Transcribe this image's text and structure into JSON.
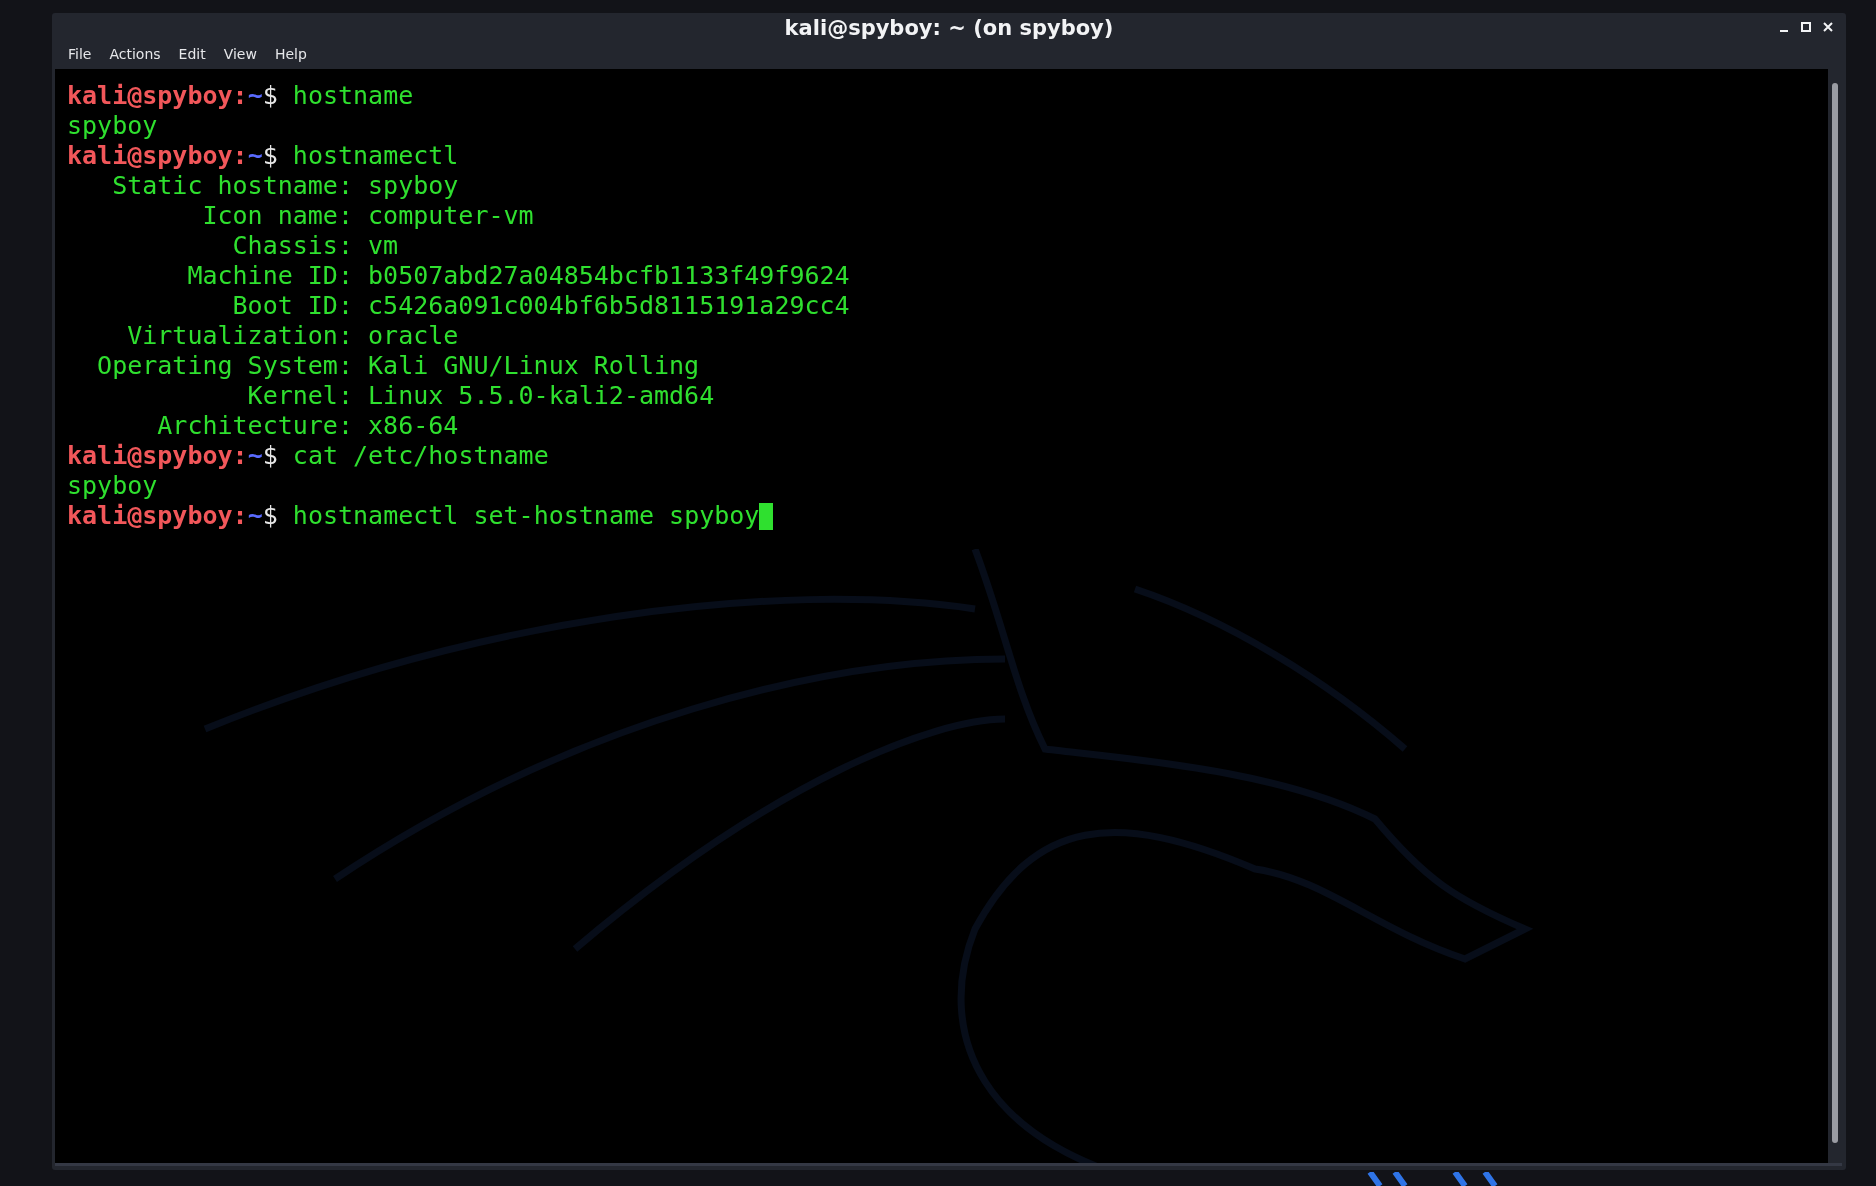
{
  "window": {
    "title": "kali@spyboy: ~ (on spyboy)"
  },
  "menu": [
    "File",
    "Actions",
    "Edit",
    "View",
    "Help"
  ],
  "terminal": {
    "lines": [
      {
        "kind": "prompt",
        "user_host": "kali@spyboy",
        "separator": ":",
        "path": "~",
        "symbol": "$",
        "command": "hostname",
        "cursor": false
      },
      {
        "kind": "output",
        "text": "spyboy"
      },
      {
        "kind": "prompt",
        "user_host": "kali@spyboy",
        "separator": ":",
        "path": "~",
        "symbol": "$",
        "command": "hostnamectl",
        "cursor": false
      },
      {
        "kind": "output",
        "text": "   Static hostname: spyboy"
      },
      {
        "kind": "output",
        "text": "         Icon name: computer-vm"
      },
      {
        "kind": "output",
        "text": "           Chassis: vm"
      },
      {
        "kind": "output",
        "text": "        Machine ID: b0507abd27a04854bcfb1133f49f9624"
      },
      {
        "kind": "output",
        "text": "           Boot ID: c5426a091c004bf6b5d8115191a29cc4"
      },
      {
        "kind": "output",
        "text": "    Virtualization: oracle"
      },
      {
        "kind": "output",
        "text": "  Operating System: Kali GNU/Linux Rolling"
      },
      {
        "kind": "output",
        "text": "            Kernel: Linux 5.5.0-kali2-amd64"
      },
      {
        "kind": "output",
        "text": "      Architecture: x86-64"
      },
      {
        "kind": "prompt",
        "user_host": "kali@spyboy",
        "separator": ":",
        "path": "~",
        "symbol": "$",
        "command": "cat /etc/hostname",
        "cursor": false
      },
      {
        "kind": "output",
        "text": "spyboy"
      },
      {
        "kind": "prompt",
        "user_host": "kali@spyboy",
        "separator": ":",
        "path": "~",
        "symbol": "$",
        "command": "hostnamectl set-hostname spyboy",
        "cursor": true
      }
    ]
  }
}
